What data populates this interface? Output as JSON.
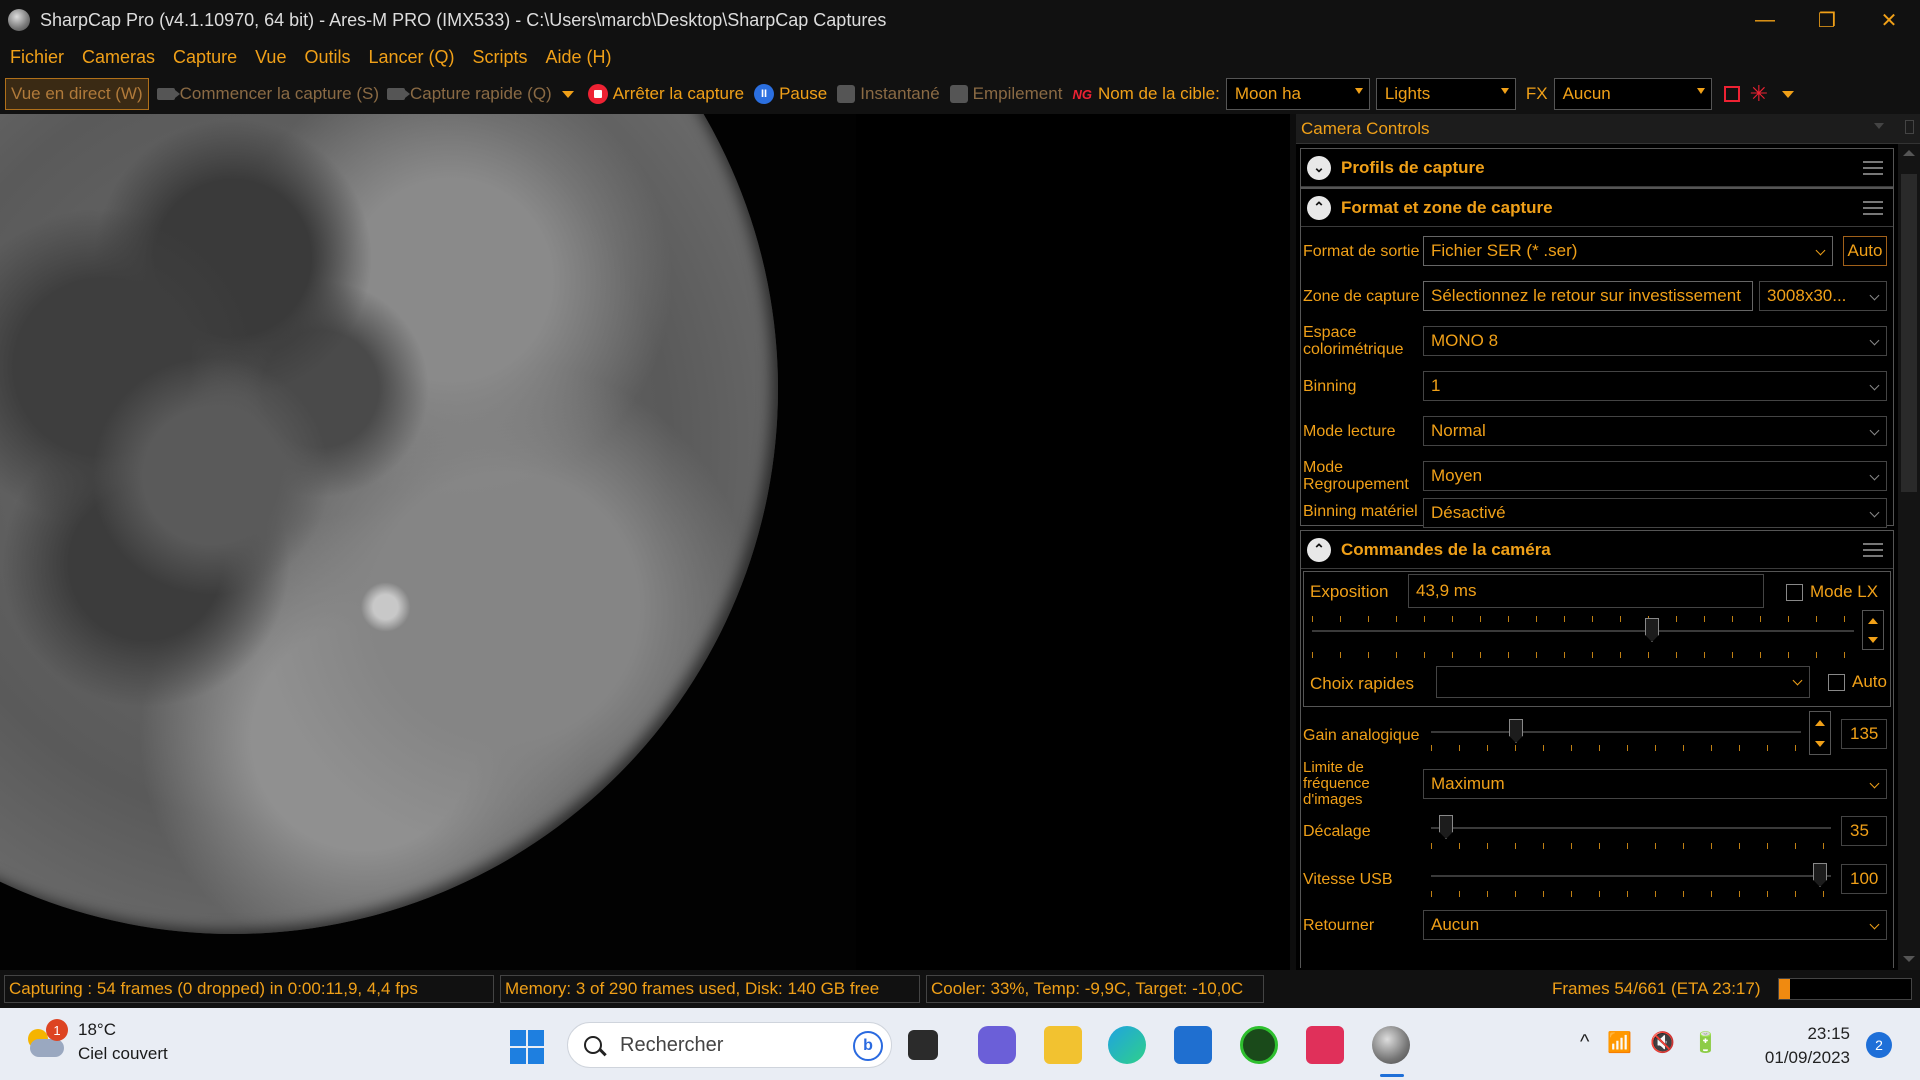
{
  "window": {
    "title": "SharpCap Pro (v4.1.10970, 64 bit) - Ares-M PRO (IMX533) - C:\\Users\\marcb\\Desktop\\SharpCap Captures",
    "minimize": "—",
    "restore": "❐",
    "close": "✕"
  },
  "menu": [
    "Fichier",
    "Cameras",
    "Capture",
    "Vue",
    "Outils",
    "Lancer (Q)",
    "Scripts",
    "Aide (H)"
  ],
  "toolbar": {
    "live_view": "Vue en direct (W)",
    "start_capture": "Commencer la capture (S)",
    "quick_capture": "Capture rapide (Q)",
    "stop_capture": "Arrêter la capture",
    "pause": "Pause",
    "snapshot": "Instantané",
    "stacking": "Empilement",
    "target_label": "Nom de la cible:",
    "target_value": "Moon ha",
    "frame_type": "Lights",
    "fx_label": "FX",
    "fx_value": "Aucun",
    "fng_icon_text": "NG"
  },
  "panel": {
    "title": "Camera Controls",
    "sections": {
      "profiles": {
        "title": "Profils de capture",
        "expanded": false
      },
      "format": {
        "title": "Format et zone de capture",
        "expanded": true,
        "output_format_label": "Format de sortie",
        "output_format_value": "Fichier SER (* .ser)",
        "auto_button": "Auto",
        "capture_area_label": "Zone de capture",
        "capture_area_roi": "Sélectionnez le retour sur investissement",
        "capture_area_size": "3008x30...",
        "color_space_label": "Espace colorimétrique",
        "color_space_value": "MONO 8",
        "binning_label": "Binning",
        "binning_value": "1",
        "read_mode_label": "Mode lecture",
        "read_mode_value": "Normal",
        "grouping_label": "Mode Regroupement",
        "grouping_value": "Moyen",
        "hw_binning_label": "Binning matériel",
        "hw_binning_value": "Désactivé"
      },
      "camera": {
        "title": "Commandes de la caméra",
        "expanded": true,
        "exposure_label": "Exposition",
        "exposure_value": "43,9 ms",
        "lx_mode_label": "Mode LX",
        "lx_mode_checked": false,
        "exposure_slider_fraction": 0.63,
        "quick_choices_label": "Choix rapides",
        "quick_choices_value": "",
        "auto_label": "Auto",
        "auto_checked": false,
        "gain_label": "Gain analogique",
        "gain_value": "135",
        "gain_slider_fraction": 0.22,
        "frame_rate_label": "Limite de fréquence d'images",
        "frame_rate_value": "Maximum",
        "offset_label": "Décalage",
        "offset_value": "35",
        "offset_slider_fraction": 0.02,
        "usb_label": "Vitesse USB",
        "usb_value": "100",
        "usb_slider_fraction": 0.99,
        "flip_label": "Retourner",
        "flip_value": "Aucun"
      }
    }
  },
  "status": {
    "capturing": "Capturing : 54 frames (0 dropped) in 0:00:11,9, 4,4 fps",
    "memory": "Memory: 3 of 290 frames used, Disk: 140 GB free",
    "cooler": "Cooler: 33%, Temp: -9,9C, Target: -10,0C",
    "frames": "Frames 54/661 (ETA 23:17)",
    "progress_fraction": 0.08
  },
  "taskbar": {
    "weather_temp": "18°C",
    "weather_desc": "Ciel couvert",
    "weather_badge": "1",
    "search_placeholder": "Rechercher",
    "bing_icon_text": "b",
    "time": "23:15",
    "date": "01/09/2023",
    "notifications": "2",
    "tray_chevron": "^"
  },
  "colors": {
    "accent": "#f0a018",
    "background": "#000000",
    "stop": "#e22233",
    "pause": "#2b6fe0",
    "progress": "#f08a10"
  }
}
